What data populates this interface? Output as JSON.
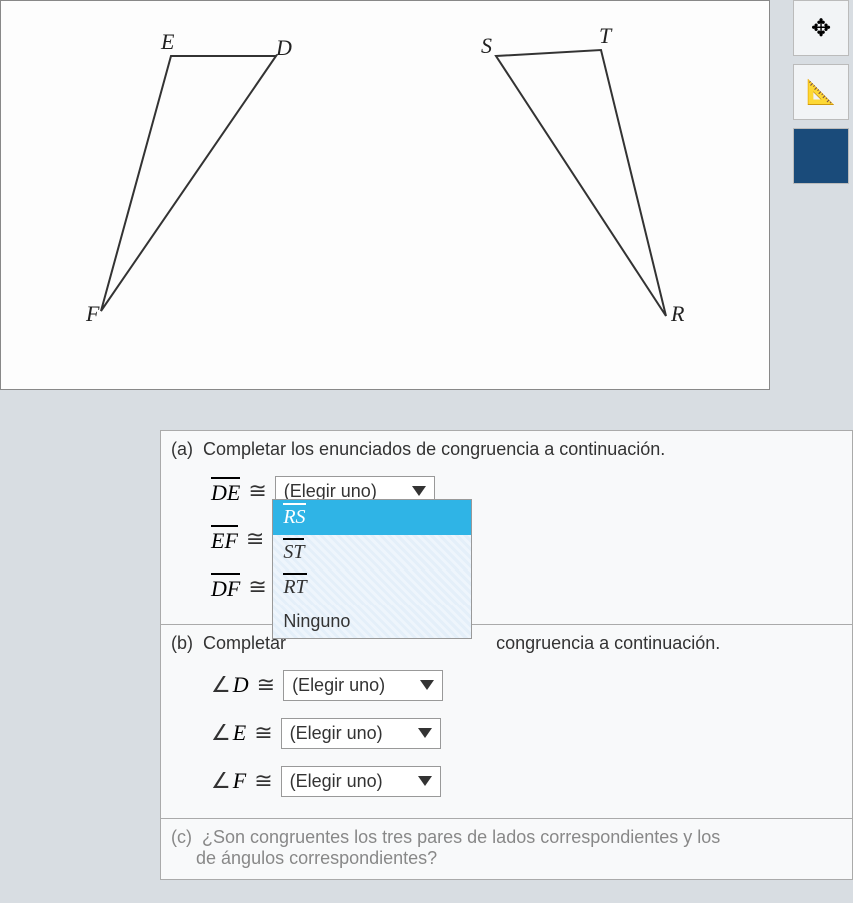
{
  "diagram": {
    "labels": {
      "E": "E",
      "D": "D",
      "F": "F",
      "S": "S",
      "T": "T",
      "R": "R"
    }
  },
  "sections": {
    "a": {
      "letter": "(a)",
      "title": "Completar los enunciados de congruencia a continuación."
    },
    "b": {
      "letter": "(b)",
      "title_before": "Completar",
      "title_after": "congruencia a continuación."
    },
    "c": {
      "letter": "(c)",
      "title": "¿Son congruentes los tres pares de lados correspondientes y los",
      "title2": "de ángulos correspondientes?"
    }
  },
  "rows": {
    "de": "DE",
    "ef": "EF",
    "df": "DF",
    "d": "D",
    "e": "E",
    "f": "F"
  },
  "dropdown": {
    "placeholder": "(Elegir uno)",
    "options": {
      "rs": "RS",
      "st": "ST",
      "rt": "RT",
      "none": "Ninguno"
    }
  },
  "symbols": {
    "congruent": "≅",
    "angle": "∠"
  }
}
